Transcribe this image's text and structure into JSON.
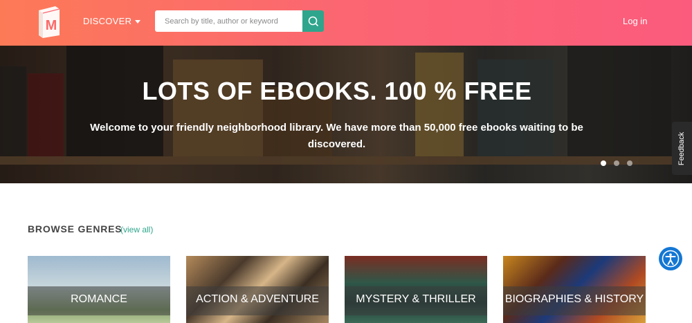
{
  "header": {
    "discover_label": "DISCOVER",
    "search": {
      "placeholder": "Search by title, author or keyword"
    },
    "login_label": "Log in"
  },
  "hero": {
    "title": "LOTS OF EBOOKS. 100 % FREE",
    "subtitle": "Welcome to your friendly neighborhood library. We have more than 50,000 free ebooks waiting to be discovered.",
    "carousel": {
      "slides": 3,
      "active": 1
    }
  },
  "feedback_label": "Feedback",
  "genres_section": {
    "title": "BROWSE GENRES",
    "view_all_label": "(view all)",
    "items": [
      {
        "label": "ROMANCE"
      },
      {
        "label": "ACTION & ADVENTURE"
      },
      {
        "label": "MYSTERY & THRILLER"
      },
      {
        "label": "BIOGRAPHIES & HISTORY"
      }
    ]
  },
  "colors": {
    "header_gradient_start": "#fd7a57",
    "header_gradient_end": "#fb5b7c",
    "accent": "#2ea58c",
    "accessibility_button": "#1477d4"
  },
  "icons": {
    "logo": "book-logo-icon",
    "search": "search-icon",
    "discover_caret": "caret-down-icon",
    "accessibility": "accessibility-icon"
  }
}
